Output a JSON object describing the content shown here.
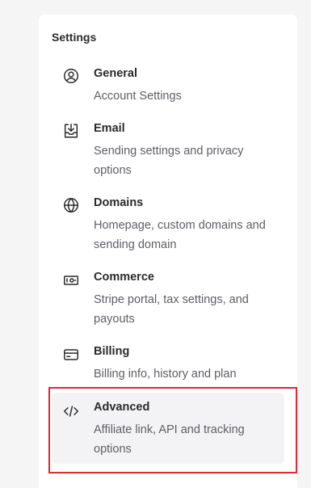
{
  "settings": {
    "title": "Settings",
    "items": [
      {
        "label": "General",
        "description": "Account Settings",
        "icon": "user-circle-icon"
      },
      {
        "label": "Email",
        "description": "Sending settings and privacy options",
        "icon": "inbox-download-icon"
      },
      {
        "label": "Domains",
        "description": "Homepage, custom domains and sending domain",
        "icon": "globe-icon"
      },
      {
        "label": "Commerce",
        "description": "Stripe portal, tax settings, and payouts",
        "icon": "banknote-icon"
      },
      {
        "label": "Billing",
        "description": "Billing info, history and plan",
        "icon": "credit-card-icon"
      },
      {
        "label": "Advanced",
        "description": "Affiliate link, API and tracking options",
        "icon": "code-icon"
      }
    ]
  },
  "colors": {
    "highlight_border": "#e3262f",
    "active_background": "#f3f3f5"
  }
}
